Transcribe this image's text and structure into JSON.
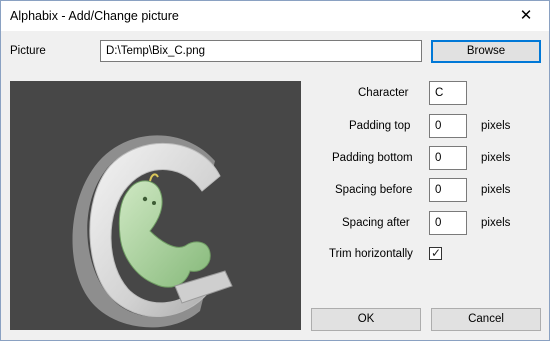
{
  "window": {
    "title": "Alphabix - Add/Change picture",
    "close_glyph": "✕"
  },
  "picture": {
    "label": "Picture",
    "path": "D:\\Temp\\Bix_C.png",
    "browse_label": "Browse"
  },
  "fields": {
    "character": {
      "label": "Character",
      "value": "C"
    },
    "padding_top": {
      "label": "Padding top",
      "value": "0",
      "unit": "pixels"
    },
    "padding_bottom": {
      "label": "Padding bottom",
      "value": "0",
      "unit": "pixels"
    },
    "spacing_before": {
      "label": "Spacing before",
      "value": "0",
      "unit": "pixels"
    },
    "spacing_after": {
      "label": "Spacing after",
      "value": "0",
      "unit": "pixels"
    }
  },
  "trim": {
    "label": "Trim horizontally",
    "checked": true,
    "check_glyph": "✓"
  },
  "buttons": {
    "ok_label": "OK",
    "cancel_label": "Cancel"
  }
}
